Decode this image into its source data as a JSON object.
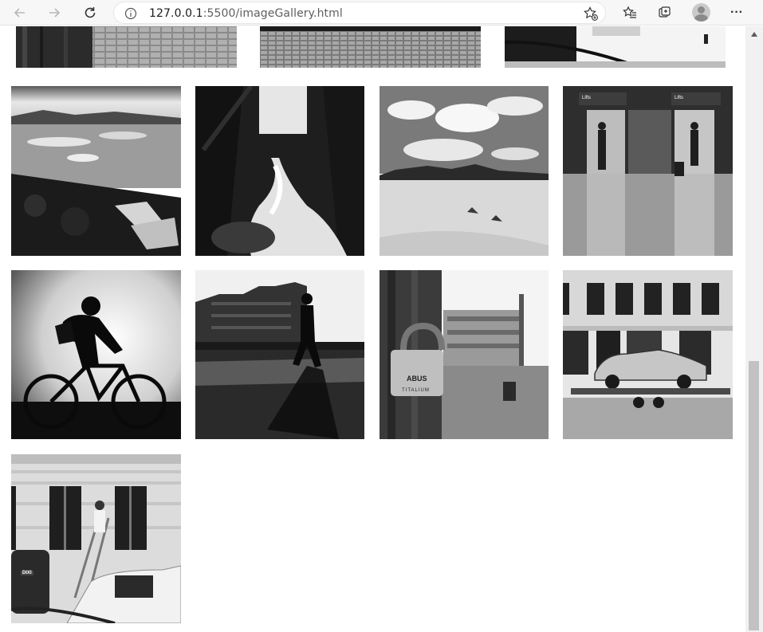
{
  "browser": {
    "url_host": "127.0.0.1",
    "url_path": ":5500/imageGallery.html",
    "back_icon": "arrow-left-icon",
    "forward_icon": "arrow-right-icon",
    "reload_icon": "reload-icon",
    "info_icon": "info-icon",
    "favorite_icon": "star-plus-icon",
    "favorites_icon": "favorites-icon",
    "collections_icon": "collections-icon",
    "profile_icon": "profile-avatar-icon",
    "more_label": "···"
  },
  "gallery": {
    "photos": [
      {
        "name": "cobblestone-wall-photo"
      },
      {
        "name": "cobblestone-street-photo"
      },
      {
        "name": "white-van-photo"
      },
      {
        "name": "glacier-lagoon-photo"
      },
      {
        "name": "forest-waterfall-photo"
      },
      {
        "name": "desert-dunes-photo"
      },
      {
        "name": "station-lifts-photo"
      },
      {
        "name": "cyclist-silhouette-photo"
      },
      {
        "name": "city-walker-silhouette-photo"
      },
      {
        "name": "abus-padlock-photo"
      },
      {
        "name": "classic-car-trailer-photo"
      },
      {
        "name": "painter-ladder-photo"
      }
    ],
    "lifts_sign_text": "Lifts",
    "lifts_sign_text_2": "Lifts",
    "padlock_brand": "ABUS",
    "padlock_model": "TITALIUM",
    "toilet_sign": "DIXI"
  }
}
